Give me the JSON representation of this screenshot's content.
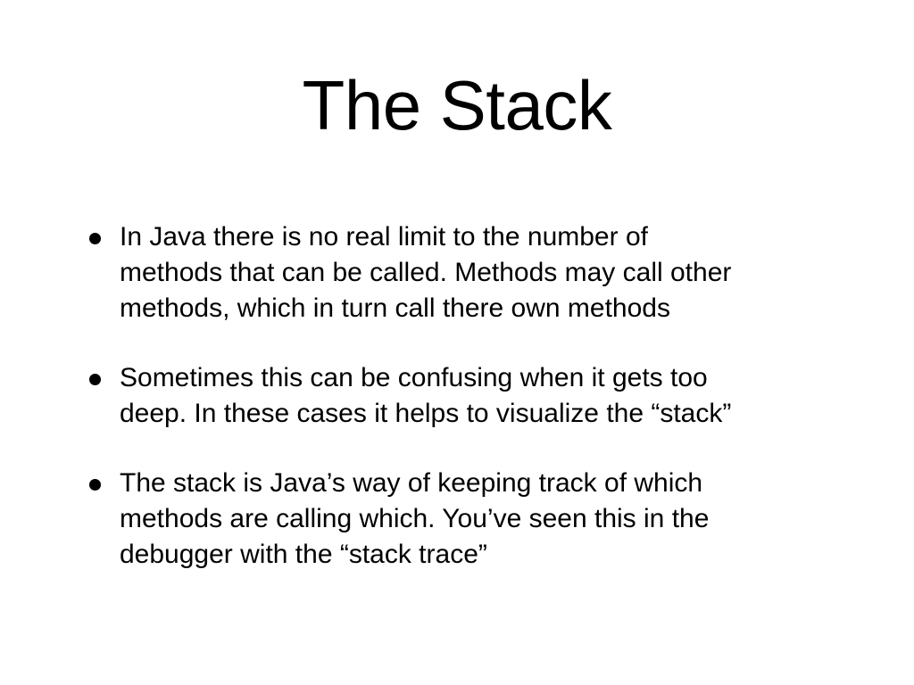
{
  "slide": {
    "title": "The Stack",
    "bullets": [
      {
        "lines": [
          "In Java there is no real limit to the number of",
          "methods that can be called. Methods may call other",
          "methods, which in turn call there own methods"
        ]
      },
      {
        "lines": [
          "Sometimes this can be confusing when it gets too",
          "deep. In these cases it helps to visualize the “stack”"
        ]
      },
      {
        "lines": [
          "The stack is Java’s way of keeping track of which",
          "methods are calling which. You’ve seen this in the",
          "debugger with the “stack trace”"
        ]
      }
    ]
  }
}
